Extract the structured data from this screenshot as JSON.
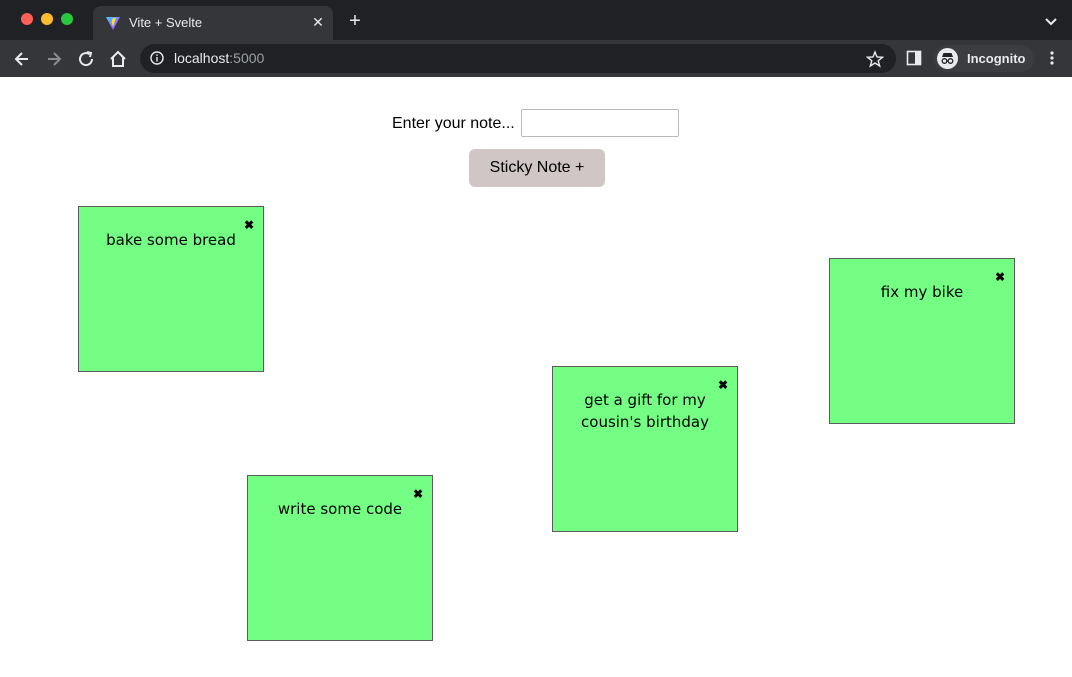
{
  "browser": {
    "tab_title": "Vite + Svelte",
    "tab_close": "✕",
    "new_tab": "+",
    "url_host": "localhost",
    "url_port": ":5000",
    "incognito_label": "Incognito"
  },
  "form": {
    "label": "Enter your note...",
    "input_value": "",
    "input_placeholder": "",
    "add_button_label": "Sticky Note +"
  },
  "notes": [
    {
      "text": "bake some bread",
      "close": "✖"
    },
    {
      "text": "fix my bike",
      "close": "✖"
    },
    {
      "text": "get a gift for my cousin's birthday",
      "close": "✖"
    },
    {
      "text": "write some code",
      "close": "✖"
    }
  ],
  "colors": {
    "note_background": "#74ff84",
    "button_background": "#d0c6c6",
    "chrome_dark": "#202124"
  }
}
